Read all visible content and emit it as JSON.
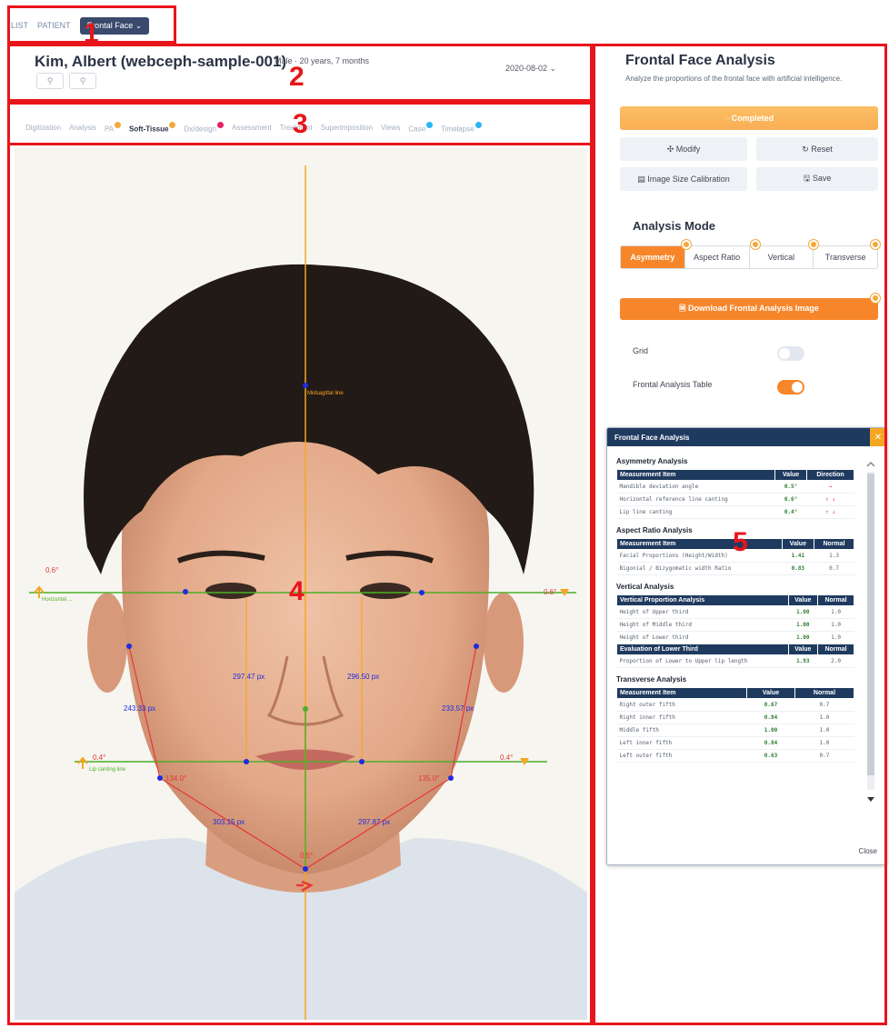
{
  "breadcrumb": {
    "list": "LIST",
    "patient": "PATIENT",
    "current": "Frontal Face ⌄"
  },
  "callouts": {
    "c1": "1",
    "c2": "2",
    "c3": "3",
    "c4": "4",
    "c5": "5"
  },
  "patient": {
    "name": "Kim, Albert (webceph-sample-001)",
    "meta": "Male · 20 years, 7 months",
    "date": "2020-08-02 ⌄",
    "btn1": "⚲",
    "btn2": "⚲"
  },
  "tabs": [
    {
      "label": "Digitization"
    },
    {
      "label": "Analysis"
    },
    {
      "label": "PA"
    },
    {
      "label": "Soft-Tissue"
    },
    {
      "label": "Dx/design"
    },
    {
      "label": "Assessment"
    },
    {
      "label": "Treatment"
    },
    {
      "label": "Superimposition"
    },
    {
      "label": "Views"
    },
    {
      "label": "Case"
    },
    {
      "label": "Timelapse"
    }
  ],
  "photo": {
    "midsagittal_label": "Midsagittal line",
    "horizontal_label": "Horizontal ...",
    "lip_label": "Lip canting line",
    "angle_left_eye": "0.6°",
    "angle_right_eye": "0.6°",
    "angle_left_lip": "0.4°",
    "angle_right_lip": "0.4°",
    "chin_angle": "0.5°",
    "dist_left_vertical": "297.47 px",
    "dist_right_vertical": "296.50 px",
    "dist_left_cheek": "243.33 px",
    "dist_right_cheek": "233.57 px",
    "dist_left_jaw": "303.15 px",
    "dist_right_jaw": "297.87 px",
    "angle_left_gonial": "134.0°",
    "angle_right_gonial": "135.0°"
  },
  "panel": {
    "title": "Frontal Face Analysis",
    "subtitle": "Analyze the proportions of the frontal face with artificial intelligence.",
    "completed": "◌ Completed",
    "modify": "✣ Modify",
    "reset": "↻ Reset",
    "calibration": "▤ Image Size Calibration",
    "save": "🖫 Save",
    "mode_title": "Analysis Mode",
    "modes": [
      "Asymmetry",
      "Aspect Ratio",
      "Vertical",
      "Transverse"
    ],
    "download": "🗎 Download Frontal Analysis Image",
    "grid": "Grid",
    "frontal_table": "Frontal Analysis Table"
  },
  "window": {
    "title": "Frontal Face Analysis",
    "close_x": "✕",
    "close": "Close",
    "asym": {
      "title": "Asymmetry Analysis",
      "headers": [
        "Measurement Item",
        "Value",
        "Direction"
      ],
      "rows": [
        [
          "Mandible deviation angle",
          "0.5°",
          "→"
        ],
        [
          "Horizontal reference line canting",
          "0.6°",
          "↑ ↓"
        ],
        [
          "Lip line canting",
          "0.4°",
          "↑ ↓"
        ]
      ]
    },
    "aspect": {
      "title": "Aspect Ratio Analysis",
      "headers": [
        "Measurement Item",
        "Value",
        "Normal"
      ],
      "rows": [
        [
          "Facial Proportions (Height/Width)",
          "1.41",
          "1.3"
        ],
        [
          "Bigonial / Bizygomatic width Ratio",
          "0.83",
          "0.7"
        ]
      ]
    },
    "vertical": {
      "title": "Vertical Analysis",
      "headers": [
        "Vertical Proportion Analysis",
        "Value",
        "Normal"
      ],
      "rows": [
        [
          "Height of Upper third",
          "1.00",
          "1.0"
        ],
        [
          "Height of Middle third",
          "1.00",
          "1.0"
        ],
        [
          "Height of Lower third",
          "1.00",
          "1.0"
        ]
      ],
      "headers2": [
        "Evaluation of Lower Third",
        "Value",
        "Normal"
      ],
      "rows2": [
        [
          "Proportion of Lower to Upper lip length",
          "1.93",
          "2.0"
        ]
      ]
    },
    "transverse": {
      "title": "Transverse Analysis",
      "headers": [
        "Measurement Item",
        "Value",
        "Normal"
      ],
      "rows": [
        [
          "Right outer fifth",
          "0.67",
          "0.7"
        ],
        [
          "Right inner fifth",
          "0.84",
          "1.0"
        ],
        [
          "Middle fifth",
          "1.00",
          "1.0"
        ],
        [
          "Left inner fifth",
          "0.84",
          "1.0"
        ],
        [
          "Left outer fifth",
          "0.63",
          "0.7"
        ]
      ]
    }
  },
  "colors": {
    "accent_orange": "#f7862b",
    "callout_red": "#e8151b",
    "navy": "#1f3a5f",
    "measure_green": "#4caf28",
    "measure_blue": "#1f2be0"
  }
}
